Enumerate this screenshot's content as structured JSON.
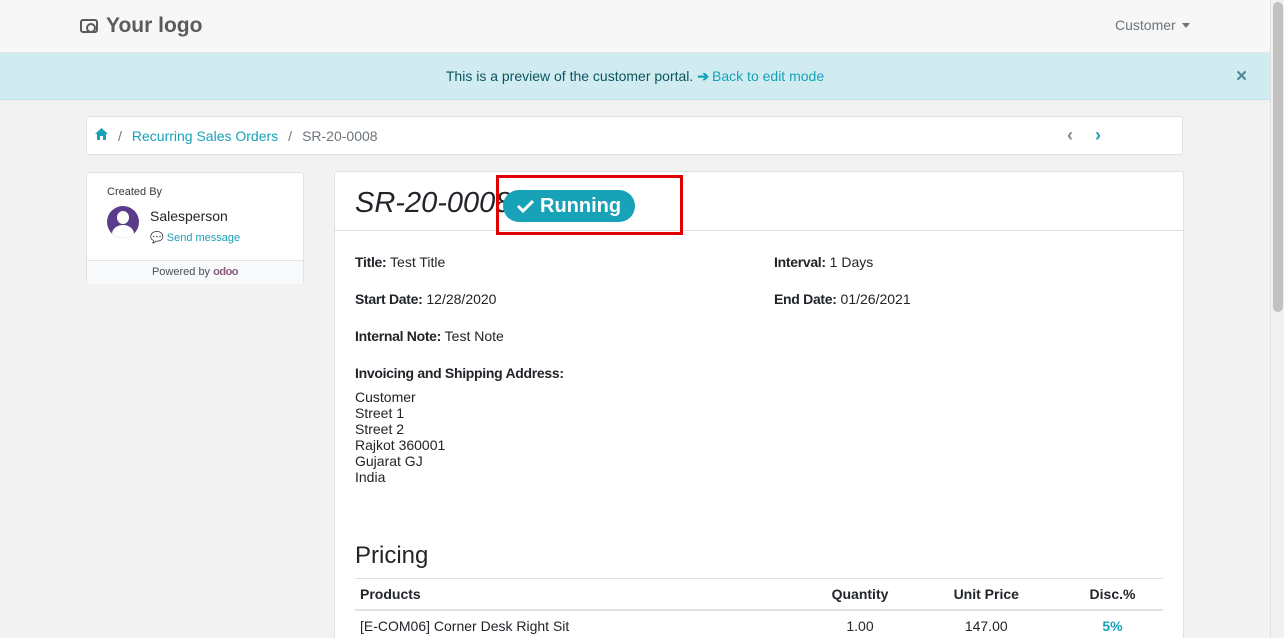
{
  "navbar": {
    "logo_text": "Your logo",
    "user_menu": "Customer"
  },
  "banner": {
    "text": "This is a preview of the customer portal.",
    "link": "Back to edit mode",
    "close": "×"
  },
  "breadcrumb": {
    "items": [
      "Recurring Sales Orders",
      "SR-20-0008"
    ],
    "separator": "/"
  },
  "sidebar": {
    "created_by_label": "Created By",
    "salesperson": "Salesperson",
    "send_message": "Send message",
    "powered_by": "Powered by",
    "brand": "odoo"
  },
  "document": {
    "title": "SR-20-0008",
    "status": "Running",
    "fields": {
      "title_label": "Title:",
      "title_value": "Test Title",
      "interval_label": "Interval:",
      "interval_value": "1 Days",
      "start_label": "Start Date:",
      "start_value": "12/28/2020",
      "end_label": "End Date:",
      "end_value": "01/26/2021",
      "note_label": "Internal Note:",
      "note_value": "Test Note",
      "address_label": "Invoicing and Shipping Address:"
    },
    "address_lines": [
      "Customer",
      "Street 1",
      "Street 2",
      "Rajkot 360001",
      "Gujarat GJ",
      "India"
    ]
  },
  "pricing": {
    "title": "Pricing",
    "columns": [
      "Products",
      "Quantity",
      "Unit Price",
      "Disc.%"
    ],
    "rows": [
      {
        "product": "[E-COM06] Corner Desk Right Sit",
        "quantity": "1.00",
        "unit_price": "147.00",
        "discount": "5%"
      }
    ]
  },
  "colors": {
    "accent": "#17a2b8",
    "banner_bg": "#d1ecf1",
    "highlight": "#e00000"
  }
}
